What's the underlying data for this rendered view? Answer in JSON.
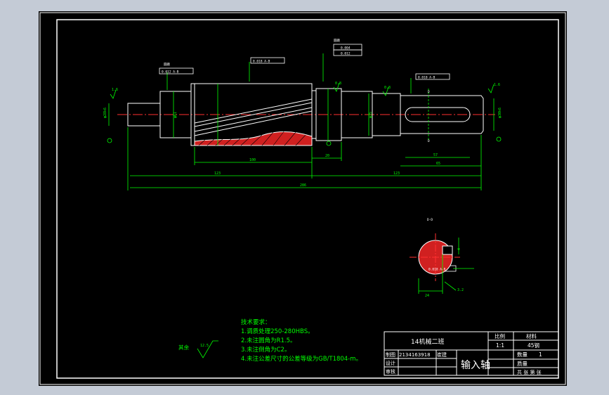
{
  "title_block": {
    "class_name": "14机械二班",
    "scale_header": "比例",
    "scale_value": "1:1",
    "material_header": "材料",
    "material_value": "45钢",
    "quantity_label": "数量",
    "quantity_value": "1",
    "mass_label": "质量",
    "drafter_label": "制图",
    "drafter_value": "2134163918",
    "drafter_name": "崔建",
    "design_label": "设计",
    "review_label": "审核",
    "part_name": "输入轴",
    "sheet_label": "共 张 第 张"
  },
  "tech_requirements": {
    "heading": "技术要求：",
    "items": [
      "1.调质处理250-280HBS。",
      "2.未注圆角为R1.5。",
      "3.未注倒角为C2。",
      "4.未注公差尺寸的公差等级为GB/T1804-m。"
    ]
  },
  "surface_finish": {
    "label": "其余",
    "value": "12.5"
  },
  "dimensions": {
    "d_left": "φ28k6",
    "d_mid": "φ61",
    "d_right_step": "φ35",
    "d_key_section": "φ30k6",
    "len_gear": "100",
    "len_shoulder": "20",
    "len_key": "57",
    "len_key_end": "65",
    "len_left": "123",
    "len_right": "123",
    "len_total": "286",
    "section_width": "24",
    "section_depth": "4",
    "roughness_a": "1.6",
    "roughness_b": "0.8",
    "roughness_c": "3.2"
  },
  "tolerance_frames": {
    "frame1": "0.012 A-B",
    "frame2": "0.018 A-B",
    "frame3": "0.010 A-B",
    "frame4": "0.018 A-B",
    "flat_value": "0.004",
    "cyl_value": "0.012",
    "ref_top": "A-B",
    "label_left": "圆跳",
    "label_top": "圆跳"
  },
  "section": {
    "label": "D-D",
    "cut_mark": "D"
  }
}
